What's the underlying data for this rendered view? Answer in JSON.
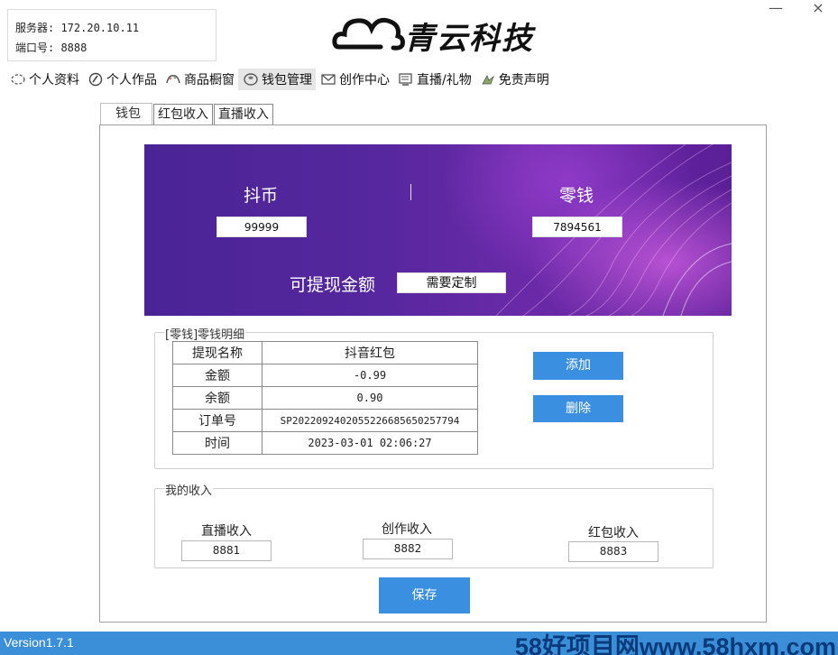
{
  "window": {
    "minimize": "—",
    "close": "×"
  },
  "server": {
    "host_line": "服务器: 172.20.10.11",
    "port_line": "端口号: 8888"
  },
  "logo": {
    "text": "青云科技",
    "icon": "cloud-icon"
  },
  "nav": [
    {
      "label": "个人资料",
      "icon": "profile-icon"
    },
    {
      "label": "个人作品",
      "icon": "works-icon"
    },
    {
      "label": "商品橱窗",
      "icon": "shop-window-icon"
    },
    {
      "label": "钱包管理",
      "icon": "wallet-icon"
    },
    {
      "label": "创作中心",
      "icon": "mail-icon"
    },
    {
      "label": "直播/礼物",
      "icon": "live-icon"
    },
    {
      "label": "免责声明",
      "icon": "disclaimer-icon"
    }
  ],
  "tabs": [
    "钱包",
    "红包收入",
    "直播收入"
  ],
  "wallet": {
    "coin_label": "抖币",
    "coin_value": "99999",
    "divider": "|",
    "change_label": "零钱",
    "change_value": "7894561",
    "withdrawable_label": "可提现金额",
    "withdrawable_value": "需要定制"
  },
  "detail": {
    "title": "[零钱]零钱明细",
    "rows": [
      {
        "key": "提现名称",
        "value": "抖音红包"
      },
      {
        "key": "金额",
        "value": "-0.99"
      },
      {
        "key": "余额",
        "value": "0.90"
      },
      {
        "key": "订单号",
        "value": "SP20220924020552266856502577​94"
      },
      {
        "key": "时间",
        "value": "2023-03-01 02:06:27"
      }
    ],
    "add_button": "添加",
    "delete_button": "删除"
  },
  "income": {
    "title": "我的收入",
    "live_label": "直播收入",
    "live_value": "8881",
    "create_label": "创作收入",
    "create_value": "8882",
    "redpacket_label": "红包收入",
    "redpacket_value": "8883"
  },
  "save_button": "保存",
  "status": {
    "version": "Version1.7.1",
    "watermark": "58好项目网www.58hxm.com"
  },
  "colors": {
    "accent_blue": "#3b8fe0",
    "statusbar_blue": "#3a8fd8",
    "banner_purple": "#56279e"
  }
}
